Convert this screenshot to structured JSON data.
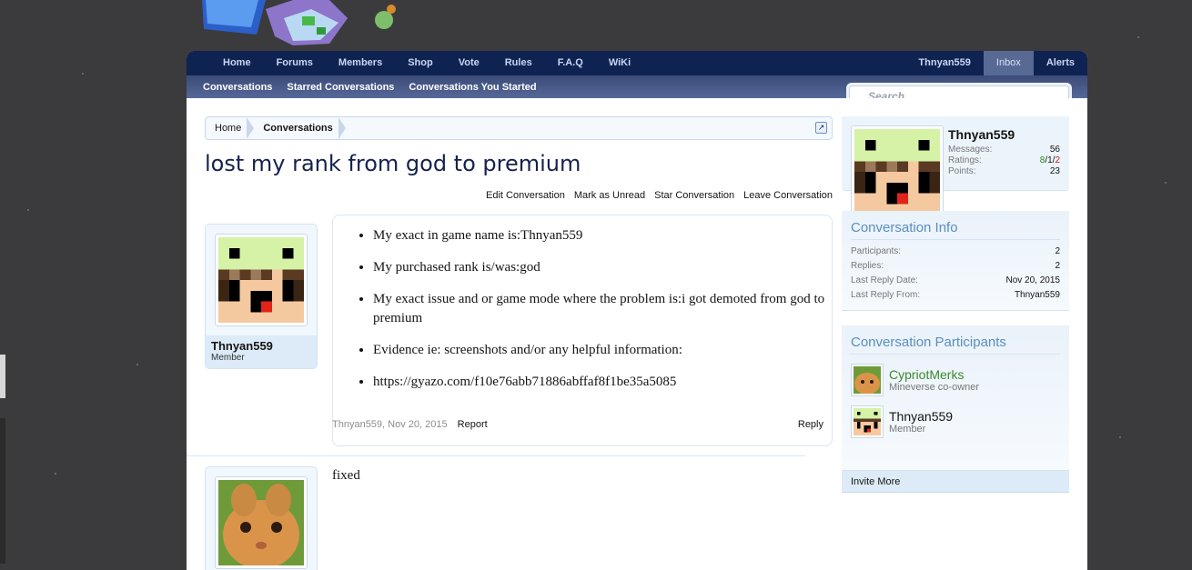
{
  "top_nav": {
    "tabs": [
      "Home",
      "Forums",
      "Members",
      "Shop",
      "Vote",
      "Rules",
      "F.A.Q",
      "WiKi"
    ],
    "user": "Thnyan559",
    "inbox": "Inbox",
    "alerts": "Alerts"
  },
  "sub_nav": [
    "Conversations",
    "Starred Conversations",
    "Conversations You Started"
  ],
  "search": {
    "placeholder": "Search..."
  },
  "breadcrumb": [
    "Home",
    "Conversations"
  ],
  "title": "lost my rank from god to premium",
  "actions": [
    "Edit Conversation",
    "Mark as Unread",
    "Star Conversation",
    "Leave Conversation"
  ],
  "messages": [
    {
      "author": "Thnyan559",
      "role": "Member",
      "lines": [
        "My exact in game name is:Thnyan559",
        "My purchased rank is/was:god",
        "My exact issue and or game mode where the problem is:i got demoted from god to premium",
        "Evidence ie: screenshots and/or any helpful information:",
        "https://gyazo.com/f10e76abb71886abffaf8f1be35a5085"
      ],
      "meta": "Thnyan559, Nov 20, 2015",
      "report": "Report",
      "reply": "Reply"
    },
    {
      "text": "fixed"
    }
  ],
  "visitor": {
    "name": "Thnyan559",
    "messages_label": "Messages:",
    "messages": "56",
    "ratings_label": "Ratings:",
    "ratings_pos": "8",
    "ratings_mid": "1",
    "ratings_neg": "2",
    "points_label": "Points:",
    "points": "23"
  },
  "conversation_info": {
    "heading": "Conversation Info",
    "participants_label": "Participants:",
    "participants": "2",
    "replies_label": "Replies:",
    "replies": "2",
    "last_date_label": "Last Reply Date:",
    "last_date": "Nov 20, 2015",
    "last_from_label": "Last Reply From:",
    "last_from": "Thnyan559"
  },
  "participants": {
    "heading": "Conversation Participants",
    "list": [
      {
        "name": "CypriotMerks",
        "role": "Mineverse co-owner"
      },
      {
        "name": "Thnyan559",
        "role": "Member"
      }
    ],
    "invite": "Invite More"
  }
}
